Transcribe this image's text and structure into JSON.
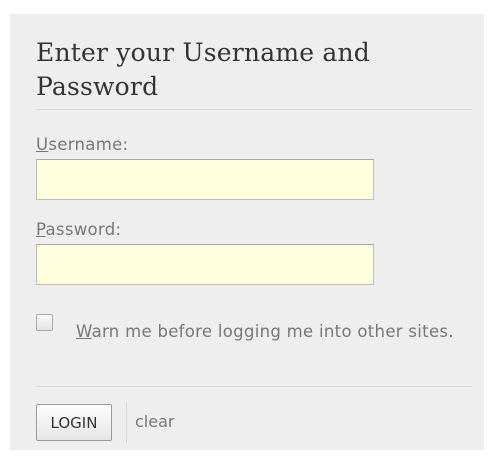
{
  "form": {
    "title": "Enter your Username and Password",
    "username": {
      "label_accesskey": "U",
      "label_rest": "sername:",
      "value": ""
    },
    "password": {
      "label_accesskey": "P",
      "label_rest": "assword:",
      "value": ""
    },
    "warn": {
      "checked": false,
      "label_accesskey": "W",
      "label_rest": "arn me before logging me into other sites."
    },
    "login_label": "LOGIN",
    "clear_label": "clear"
  },
  "colors": {
    "panel_background": "#eeeeee",
    "input_background": "#ffffdd",
    "label_text": "#777777",
    "title_text": "#333333"
  }
}
